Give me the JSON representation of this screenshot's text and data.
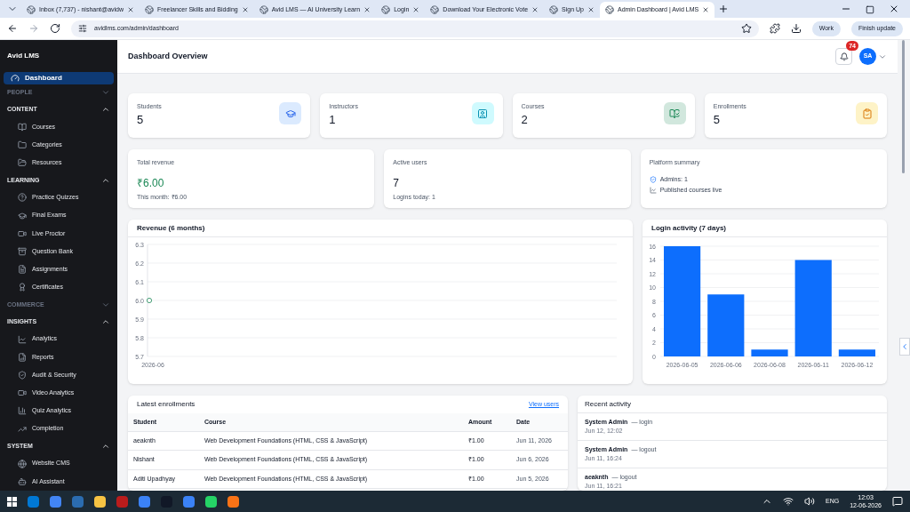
{
  "browser": {
    "tabs": [
      {
        "title": "Inbox (7,737) - nishant@avidw",
        "selected": false
      },
      {
        "title": "Freelancer Skills and Bidding",
        "selected": false
      },
      {
        "title": "Avid LMS — AI University Learn",
        "selected": false
      },
      {
        "title": "Login",
        "selected": false
      },
      {
        "title": "Download Your Electronic Vote",
        "selected": false
      },
      {
        "title": "Sign Up",
        "selected": false
      },
      {
        "title": "Admin Dashboard | Avid LMS",
        "selected": true
      }
    ],
    "url": "avidlms.com/admin/dashboard",
    "profile": "Work",
    "update_button": "Finish update"
  },
  "sidebar": {
    "brand": "Avid LMS",
    "sections": [
      {
        "label": "Dashboard",
        "kind": "link",
        "selected": true
      },
      {
        "label": "PEOPLE",
        "kind": "group",
        "expanded": false
      },
      {
        "label": "CONTENT",
        "kind": "group",
        "expanded": true,
        "children": [
          {
            "label": "Courses"
          },
          {
            "label": "Categories"
          },
          {
            "label": "Resources"
          }
        ]
      },
      {
        "label": "LEARNING",
        "kind": "group",
        "expanded": true,
        "children": [
          {
            "label": "Practice Quizzes"
          },
          {
            "label": "Final Exams"
          },
          {
            "label": "Live Proctor"
          },
          {
            "label": "Question Bank"
          },
          {
            "label": "Assignments"
          },
          {
            "label": "Certificates"
          }
        ]
      },
      {
        "label": "COMMERCE",
        "kind": "group",
        "expanded": false
      },
      {
        "label": "INSIGHTS",
        "kind": "group",
        "expanded": true,
        "children": [
          {
            "label": "Analytics"
          },
          {
            "label": "Reports"
          },
          {
            "label": "Audit & Security"
          },
          {
            "label": "Video Analytics"
          },
          {
            "label": "Quiz Analytics"
          },
          {
            "label": "Completion"
          }
        ]
      },
      {
        "label": "SYSTEM",
        "kind": "group",
        "expanded": true,
        "children": [
          {
            "label": "Website CMS"
          },
          {
            "label": "AI Assistant"
          }
        ]
      }
    ]
  },
  "header": {
    "title": "Dashboard Overview",
    "notifications": "74",
    "avatar": "SA"
  },
  "stats": [
    {
      "label": "Students",
      "value": "5",
      "color": "#dbeafe"
    },
    {
      "label": "Instructors",
      "value": "1",
      "color": "#cffafe"
    },
    {
      "label": "Courses",
      "value": "2",
      "color": "#d1e7dd"
    },
    {
      "label": "Enrollments",
      "value": "5",
      "color": "#fef3c7"
    }
  ],
  "revenue_card": {
    "label": "Total revenue",
    "value": "₹6.00",
    "note": "This month: ₹6.00"
  },
  "users_card": {
    "label": "Active users",
    "value": "7",
    "note": "Logins today: 1"
  },
  "summary_card": {
    "label": "Platform summary",
    "lines": [
      "Admins: 1",
      "Published courses live"
    ]
  },
  "revenue_chart": {
    "title": "Revenue (6 months)",
    "chart_data": {
      "type": "line",
      "categories": [
        "2026-06"
      ],
      "grid": true,
      "series": [
        {
          "color": "#198754",
          "marker": "circle",
          "values": [
            6.0
          ]
        }
      ],
      "ylim": [
        5.7,
        6.3
      ],
      "yticks": [
        {
          "value": 5.7,
          "label": "5.7"
        },
        {
          "value": 5.8,
          "label": "5.8"
        },
        {
          "value": 5.9,
          "label": "5.9"
        },
        {
          "value": 6.0,
          "label": "6.0"
        },
        {
          "value": 6.1,
          "label": "6.1"
        },
        {
          "value": 6.2,
          "label": "6.2"
        },
        {
          "value": 6.3,
          "label": "6.3"
        }
      ]
    }
  },
  "login_chart": {
    "title": "Login activity (7 days)",
    "chart_data": {
      "type": "bar",
      "categories": [
        "2026-06-05",
        "2026-06-06",
        "2026-06-08",
        "2026-06-11",
        "2026-06-12"
      ],
      "grid": true,
      "series": [
        {
          "color": "#0d6efd",
          "values": [
            16,
            9,
            1,
            14,
            1
          ]
        }
      ],
      "ylim": [
        0,
        16
      ],
      "yticks": [
        0,
        2,
        4,
        6,
        8,
        10,
        12,
        14,
        16
      ]
    }
  },
  "enrollments": {
    "title": "Latest enrollments",
    "link": "View users",
    "columns": [
      "Student",
      "Course",
      "Amount",
      "Date"
    ],
    "rows": [
      [
        "aeaknth",
        "Web Development Foundations (HTML, CSS & JavaScript)",
        "₹1.00",
        "Jun 11, 2026"
      ],
      [
        "Nishant",
        "Web Development Foundations (HTML, CSS & JavaScript)",
        "₹1.00",
        "Jun 6, 2026"
      ],
      [
        "Aditi Upadhyay",
        "Web Development Foundations (HTML, CSS & JavaScript)",
        "₹1.00",
        "Jun 5, 2026"
      ]
    ]
  },
  "activity": {
    "title": "Recent activity",
    "items": [
      {
        "user": "System Admin",
        "action": "— login",
        "time": "Jun 12, 12:02"
      },
      {
        "user": "System Admin",
        "action": "— logout",
        "time": "Jun 11, 16:24"
      },
      {
        "user": "aeaknth",
        "action": "— logout",
        "time": "Jun 11, 16:21"
      }
    ]
  },
  "taskbar": {
    "language": "ENG",
    "time": "12:03",
    "date": "12-06-2026"
  }
}
